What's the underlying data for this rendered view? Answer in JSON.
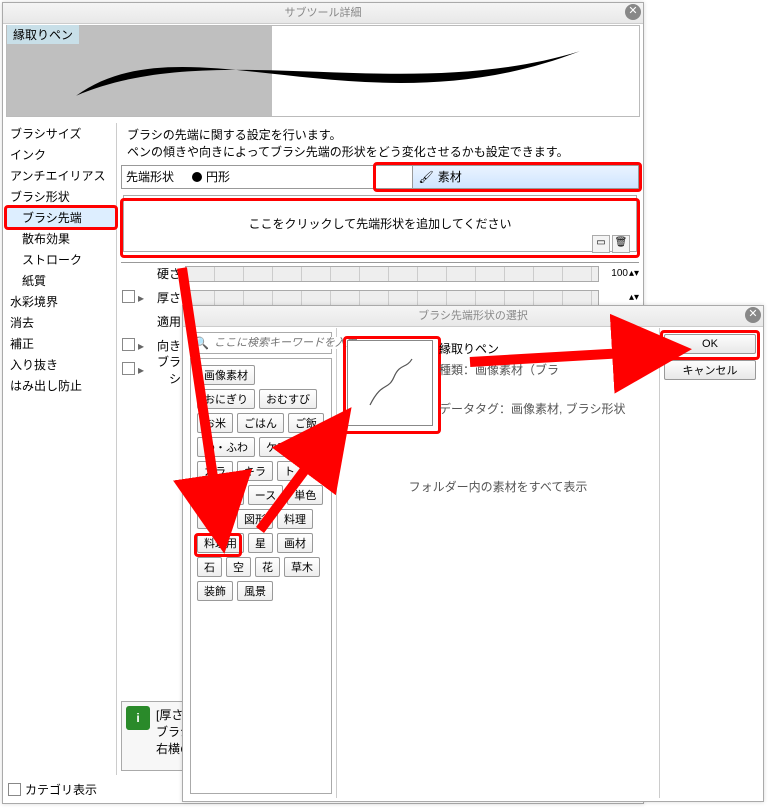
{
  "window1": {
    "title": "サブツール詳細",
    "subtool_name": "縁取りペン",
    "description_line1": "ブラシの先端に関する設定を行います。",
    "description_line2": "ペンの傾きや向きによってブラシ先端の形状をどう変化させるかも設定できます。",
    "sidebar": [
      "ブラシサイズ",
      "インク",
      "アンチエイリアス",
      "ブラシ形状",
      "ブラシ先端",
      "散布効果",
      "ストローク",
      "紙質",
      "水彩境界",
      "消去",
      "補正",
      "入り抜き",
      "はみ出し防止"
    ],
    "tip_shape_label": "先端形状",
    "tip_shape_circle": "円形",
    "tip_shape_material": "素材",
    "add_tip_text": "ここをクリックして先端形状を追加してください",
    "sliders": {
      "hardness": "硬さ",
      "thickness": "厚さ",
      "apply": "適用",
      "direction": "向き",
      "brush": "ブラシ"
    },
    "slider_hardness_value": "100",
    "info_label": "[厚さ]",
    "info_text1": "ブラシの先端の",
    "info_text2": "右横の[影響す",
    "footer_checkbox": "カテゴリ表示"
  },
  "window2": {
    "title": "ブラシ先端形状の選択",
    "search_placeholder": "ここに検索キーワードを入力して",
    "tag_head": "画像素材",
    "tags": [
      "おにぎり",
      "おむすび",
      "お米",
      "ごはん",
      "ご飯",
      "わ・ふわ",
      "ケアミ",
      "カラ",
      "キラ",
      "ト",
      "ブラシ",
      "ース",
      "単色",
      "和柄",
      "図形",
      "料理",
      "料理用",
      "星",
      "画材",
      "石",
      "空",
      "花",
      "草木",
      "装飾",
      "風景"
    ],
    "result": {
      "title": "縁取りペン",
      "kind_label": "種類：",
      "kind_value": "画像素材（ブラ",
      "tags_label": "データタグ：",
      "tags_value": "画像素材, ブラシ形状"
    },
    "show_all": "フォルダー内の素材をすべて表示",
    "ok": "OK",
    "cancel": "キャンセル"
  }
}
